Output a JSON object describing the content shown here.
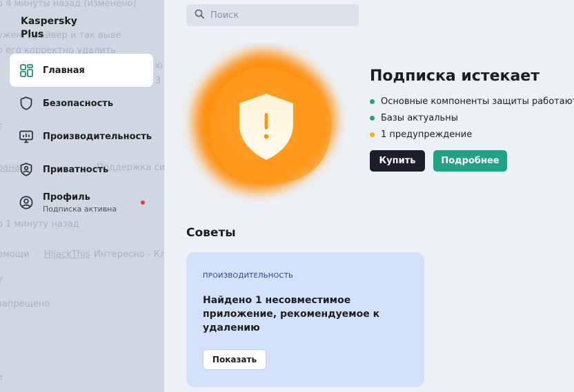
{
  "app": {
    "name": "Kaspersky Plus"
  },
  "background_text": [
    "о 4 минуты назад (изменено)",
    "ужен, драйвер и так выве",
    "о его корректно удалить",
    "ю",
    "3",
    "т",
    "рана",
    "Поддержка системных",
    "о 1 минуту назад",
    "омощи",
    "HijackThis",
    "Интересно - Кл",
    "у",
    "запрещено",
    "е"
  ],
  "sidebar": {
    "items": [
      {
        "id": "home",
        "label": "Главная",
        "icon": "home-grid-icon",
        "active": true
      },
      {
        "id": "security",
        "label": "Безопасность",
        "icon": "shield-icon",
        "active": false
      },
      {
        "id": "performance",
        "label": "Производительность",
        "icon": "monitor-icon",
        "active": false
      },
      {
        "id": "privacy",
        "label": "Приватность",
        "icon": "privacy-shield-icon",
        "active": false
      },
      {
        "id": "profile",
        "label": "Профиль",
        "sublabel": "Подписка активна",
        "icon": "user-icon",
        "active": false,
        "badge": true
      }
    ]
  },
  "search": {
    "placeholder": "Поиск"
  },
  "status": {
    "title": "Подписка истекает",
    "items": [
      {
        "text": "Основные компоненты защиты работают",
        "color": "#23a184"
      },
      {
        "text": "Базы актуальны",
        "color": "#23a184"
      },
      {
        "text": "1 предупреждение",
        "color": "#f0b030"
      }
    ],
    "buy_label": "Купить",
    "more_label": "Подробнее"
  },
  "tips": {
    "title": "Советы",
    "card": {
      "category": "ПРОИЗВОДИТЕЛЬНОСТЬ",
      "text": "Найдено 1 несовместимое приложение, рекомендуемое к удалению",
      "button_label": "Показать"
    }
  },
  "colors": {
    "accent_green": "#23a184",
    "buy_dark": "#1d1d2b",
    "warning_orange": "#ff8a00",
    "card_blue": "#d3e1fd",
    "badge_red": "#e6383c"
  }
}
